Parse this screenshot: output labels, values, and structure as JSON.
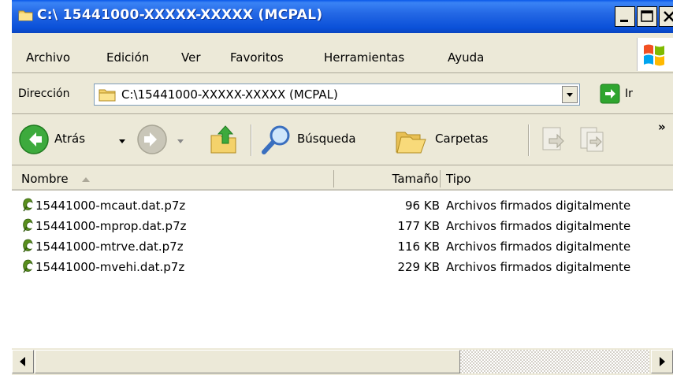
{
  "window": {
    "title": "C:\\ 15441000-XXXXX-XXXXX (MCPAL)"
  },
  "menu": {
    "items": [
      "Archivo",
      "Edición",
      "Ver",
      "Favoritos",
      "Herramientas",
      "Ayuda"
    ]
  },
  "address": {
    "label": "Dirección",
    "value": "C:\\15441000-XXXXX-XXXXX (MCPAL)",
    "go_label": "Ir"
  },
  "toolbar": {
    "back_label": "Atrás",
    "search_label": "Búsqueda",
    "folders_label": "Carpetas",
    "overflow": "»"
  },
  "list": {
    "columns": [
      "Nombre",
      "Tamaño",
      "Tipo"
    ],
    "rows": [
      {
        "name": "15441000-mcaut.dat.p7z",
        "size": "96 KB",
        "type": "Archivos firmados digitalmente"
      },
      {
        "name": "15441000-mprop.dat.p7z",
        "size": "177 KB",
        "type": "Archivos firmados digitalmente"
      },
      {
        "name": "15441000-mtrve.dat.p7z",
        "size": "116 KB",
        "type": "Archivos firmados digitalmente"
      },
      {
        "name": "15441000-mvehi.dat.p7z",
        "size": "229 KB",
        "type": "Archivos firmados digitalmente"
      }
    ]
  },
  "colors": {
    "titlebar": "#0A50D8",
    "chrome": "#ECE9D8",
    "go_green": "#2FA52F"
  }
}
